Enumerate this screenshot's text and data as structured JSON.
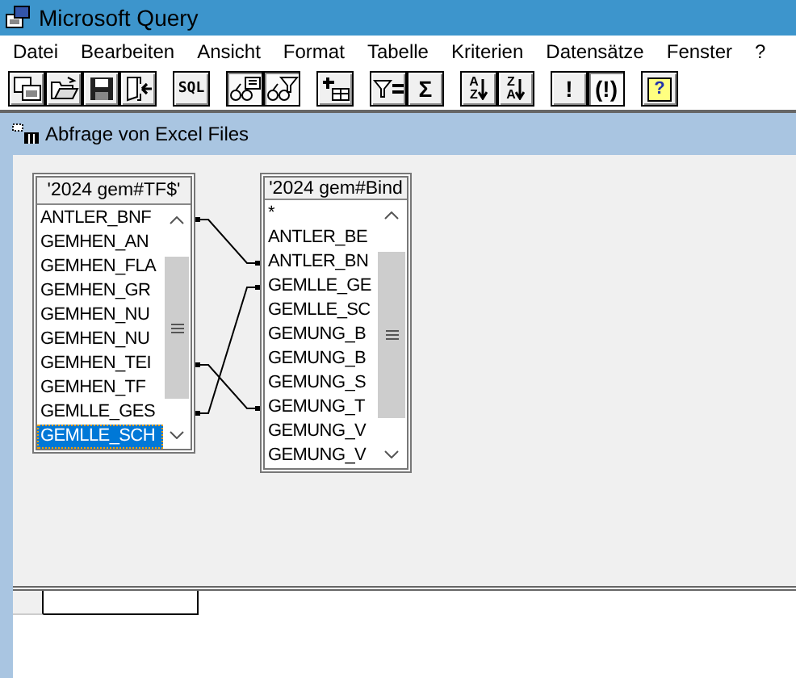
{
  "window": {
    "title": "Microsoft Query"
  },
  "menu": [
    "Datei",
    "Bearbeiten",
    "Ansicht",
    "Format",
    "Tabelle",
    "Kriterien",
    "Datensätze",
    "Fenster",
    "?"
  ],
  "toolbar": [
    {
      "kind": "icon",
      "pressed": false
    },
    {
      "kind": "icon",
      "pressed": false
    },
    {
      "kind": "icon",
      "pressed": false
    },
    {
      "kind": "icon",
      "pressed": false
    },
    {
      "kind": "text",
      "label": "SQL",
      "pressed": false
    },
    {
      "kind": "icon",
      "pressed": true
    },
    {
      "kind": "icon",
      "pressed": true
    },
    {
      "kind": "icon",
      "pressed": false
    },
    {
      "kind": "icon",
      "pressed": false
    },
    {
      "kind": "text",
      "label": "Σ",
      "pressed": false
    },
    {
      "kind": "sort",
      "top": "A",
      "bottom": "Z",
      "pressed": false
    },
    {
      "kind": "sort",
      "top": "Z",
      "bottom": "A",
      "pressed": false
    },
    {
      "kind": "text",
      "label": "!",
      "pressed": false
    },
    {
      "kind": "text",
      "label": "(!)",
      "pressed": true
    },
    {
      "kind": "help",
      "label": "?",
      "pressed": false
    }
  ],
  "query_window": {
    "title": "Abfrage von Excel Files"
  },
  "tables": [
    {
      "title": "'2024 gem#TF$'",
      "fields": [
        {
          "name": "ANTLER_BNF",
          "selected": false
        },
        {
          "name": "GEMHEN_AN",
          "selected": false
        },
        {
          "name": "GEMHEN_FLA",
          "selected": false
        },
        {
          "name": "GEMHEN_GR",
          "selected": false
        },
        {
          "name": "GEMHEN_NU",
          "selected": false
        },
        {
          "name": "GEMHEN_NU",
          "selected": false
        },
        {
          "name": "GEMHEN_TEI",
          "selected": false
        },
        {
          "name": "GEMHEN_TF",
          "selected": false
        },
        {
          "name": "GEMLLE_GES",
          "selected": false
        },
        {
          "name": "GEMLLE_SCH",
          "selected": true
        }
      ]
    },
    {
      "title": "'2024 gem#Bind",
      "fields": [
        {
          "name": "*",
          "selected": false
        },
        {
          "name": "ANTLER_BE",
          "selected": false
        },
        {
          "name": "ANTLER_BN",
          "selected": false
        },
        {
          "name": "GEMLLE_GE",
          "selected": false
        },
        {
          "name": "GEMLLE_SC",
          "selected": false
        },
        {
          "name": "GEMUNG_B",
          "selected": false
        },
        {
          "name": "GEMUNG_B",
          "selected": false
        },
        {
          "name": "GEMUNG_S",
          "selected": false
        },
        {
          "name": "GEMUNG_T",
          "selected": false
        },
        {
          "name": "GEMUNG_V",
          "selected": false
        },
        {
          "name": "GEMUNG_V",
          "selected": false
        }
      ]
    }
  ]
}
